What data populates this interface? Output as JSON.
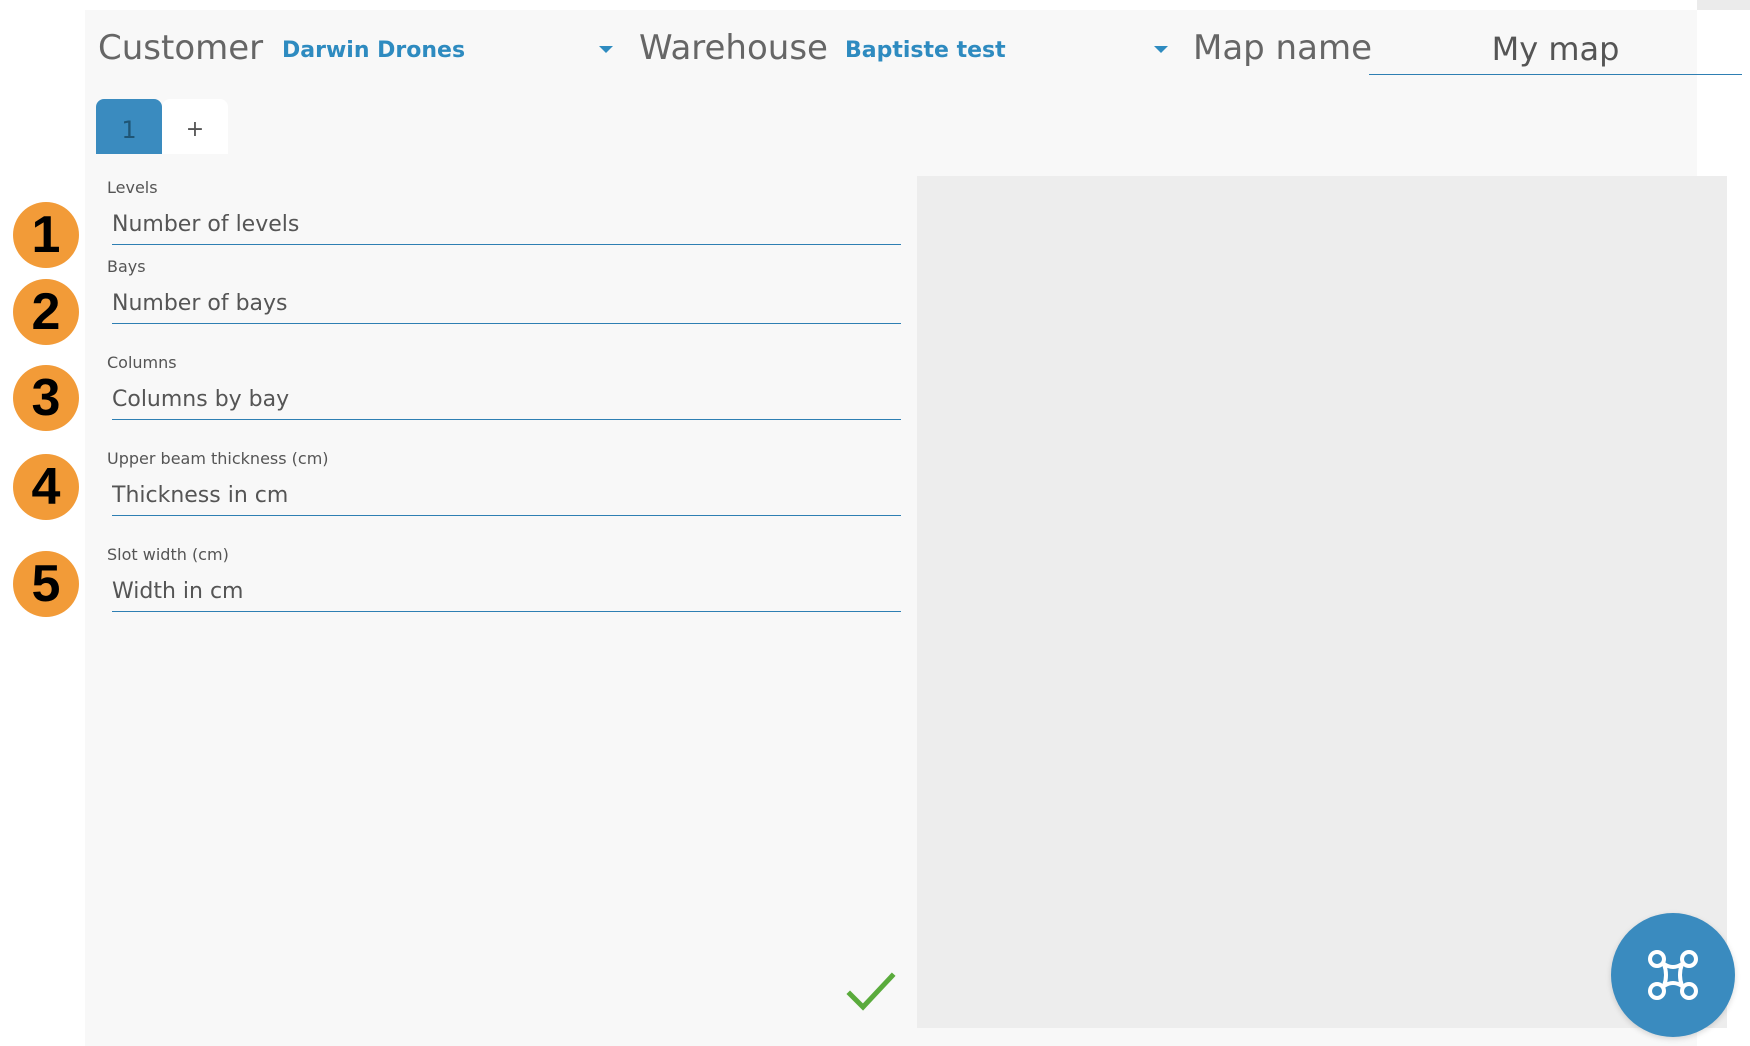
{
  "header": {
    "customer_label": "Customer",
    "customer_value": "Darwin Drones",
    "warehouse_label": "Warehouse",
    "warehouse_value": "Baptiste test",
    "map_name_label": "Map name",
    "map_name_value": "My map"
  },
  "tabs": [
    {
      "label": "1",
      "active": true
    },
    {
      "label": "+",
      "active": false
    }
  ],
  "fields": [
    {
      "marker": "1",
      "label": "Levels",
      "placeholder": "Number of levels"
    },
    {
      "marker": "2",
      "label": "Bays",
      "placeholder": "Number of bays"
    },
    {
      "marker": "3",
      "label": "Columns",
      "placeholder": "Columns by bay"
    },
    {
      "marker": "4",
      "label": "Upper beam thickness (cm)",
      "placeholder": "Thickness in cm"
    },
    {
      "marker": "5",
      "label": "Slot width (cm)",
      "placeholder": "Width in cm"
    }
  ],
  "actions": {
    "confirm_icon": "check-icon",
    "fab_icon": "drone-icon"
  },
  "colors": {
    "accent": "#2e8bc0",
    "fab": "#3a8bbf",
    "marker": "#f29b38",
    "confirm": "#5aab3c"
  }
}
